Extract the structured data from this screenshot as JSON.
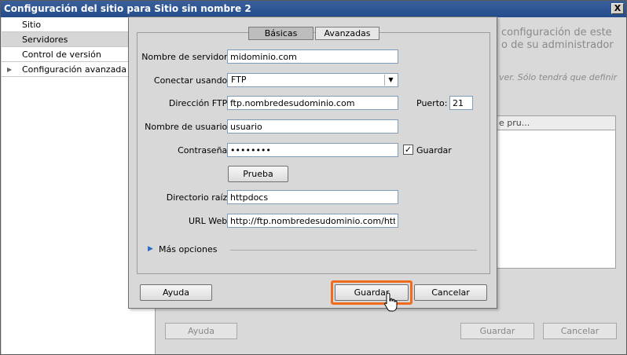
{
  "outer_window": {
    "title": "Configuración del sitio para Sitio sin nombre 2",
    "close_glyph": "X"
  },
  "sidebar": {
    "items": [
      {
        "label": "Sitio"
      },
      {
        "label": "Servidores"
      },
      {
        "label": "Control de versión"
      },
      {
        "label": "Configuración avanzada"
      }
    ],
    "expand_glyph": "▶"
  },
  "background": {
    "info_line1": "configuración de este",
    "info_line2": "o de su administrador",
    "info_italic": "ver. Sólo tendrá que definir",
    "panel_header": "e pru...",
    "help_label": "Ayuda",
    "save_label": "Guardar",
    "cancel_label": "Cancelar"
  },
  "dialog": {
    "tabs": [
      {
        "label": "Básicas",
        "active": true
      },
      {
        "label": "Avanzadas",
        "active": false
      }
    ],
    "fields": {
      "server_name_label": "Nombre de servidor:",
      "server_name_value": "midominio.com",
      "connect_label": "Conectar usando:",
      "connect_value": "FTP",
      "ftp_address_label": "Dirección FTP:",
      "ftp_address_value": "ftp.nombredesudominio.com",
      "port_label": "Puerto:",
      "port_value": "21",
      "username_label": "Nombre de usuario:",
      "username_value": "usuario",
      "password_label": "Contraseña:",
      "password_value": "••••••••",
      "save_password_label": "Guardar",
      "save_password_checked": "✓",
      "test_button_label": "Prueba",
      "root_dir_label": "Directorio raíz:",
      "root_dir_value": "httpdocs",
      "web_url_label": "URL Web:",
      "web_url_value": "http://ftp.nombredesudominio.com/httpdocs/"
    },
    "more_options_label": "Más opciones",
    "more_options_glyph": "▶",
    "help_label": "Ayuda",
    "save_label": "Guardar",
    "cancel_label": "Cancelar",
    "select_arrow_glyph": "▼"
  },
  "colors": {
    "highlight": "#f06c1c",
    "titlebar": "#244c8c",
    "disclosure": "#2b6cc4"
  }
}
